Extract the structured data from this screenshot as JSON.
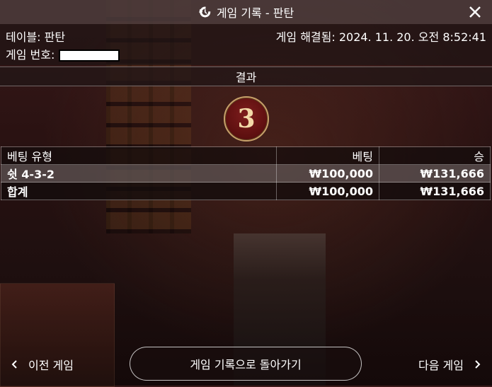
{
  "header": {
    "title": "게임 기록 - 판탄",
    "history_icon": "history-icon",
    "close_icon": "close-icon"
  },
  "info": {
    "table_label": "테이블: 판탄",
    "resolved_label": "게임 해결됨: 2024. 11. 20. 오전 8:52:41",
    "game_number_label": "게임 번호:"
  },
  "result": {
    "header": "결과",
    "value": "3"
  },
  "bets_table": {
    "headers": [
      "베팅 유형",
      "베팅",
      "승"
    ],
    "rows": [
      {
        "type": "쉿 4-3-2",
        "bet": "₩100,000",
        "win": "₩131,666"
      }
    ],
    "total": {
      "type": "합계",
      "bet": "₩100,000",
      "win": "₩131,666"
    }
  },
  "footer": {
    "prev_label": "이전 게임",
    "back_label": "게임 기록으로 돌아가기",
    "next_label": "다음 게임"
  },
  "colors": {
    "badge_bg": "#5c0f0f",
    "badge_border": "#c7a06a"
  }
}
